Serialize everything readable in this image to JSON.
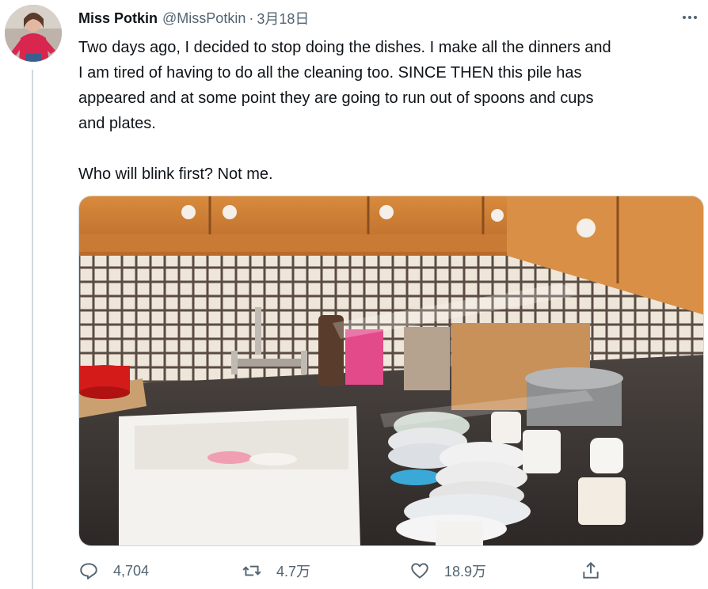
{
  "tweet": {
    "author_name": "Miss Potkin",
    "author_handle": "@MissPotkin",
    "separator": "·",
    "date": "3月18日",
    "more_icon": "more-horizontal-icon",
    "text": "Two days ago, I decided to stop doing the dishes. I make all the dinners and\nI am tired of having to do all the cleaning too. SINCE THEN this pile has\nappeared and at some point they are going to run out of spoons and cups\nand plates.\n\nWho will blink first? Not me.",
    "media": {
      "type": "photo"
    }
  },
  "actions": {
    "reply": {
      "icon": "reply-icon",
      "count": "4,704"
    },
    "retweet": {
      "icon": "retweet-icon",
      "count": "4.7万"
    },
    "like": {
      "icon": "heart-icon",
      "count": "18.9万"
    },
    "share": {
      "icon": "share-icon"
    }
  },
  "colors": {
    "text_primary": "#0f1419",
    "text_secondary": "#536471",
    "thread_line": "#cfd9de"
  }
}
